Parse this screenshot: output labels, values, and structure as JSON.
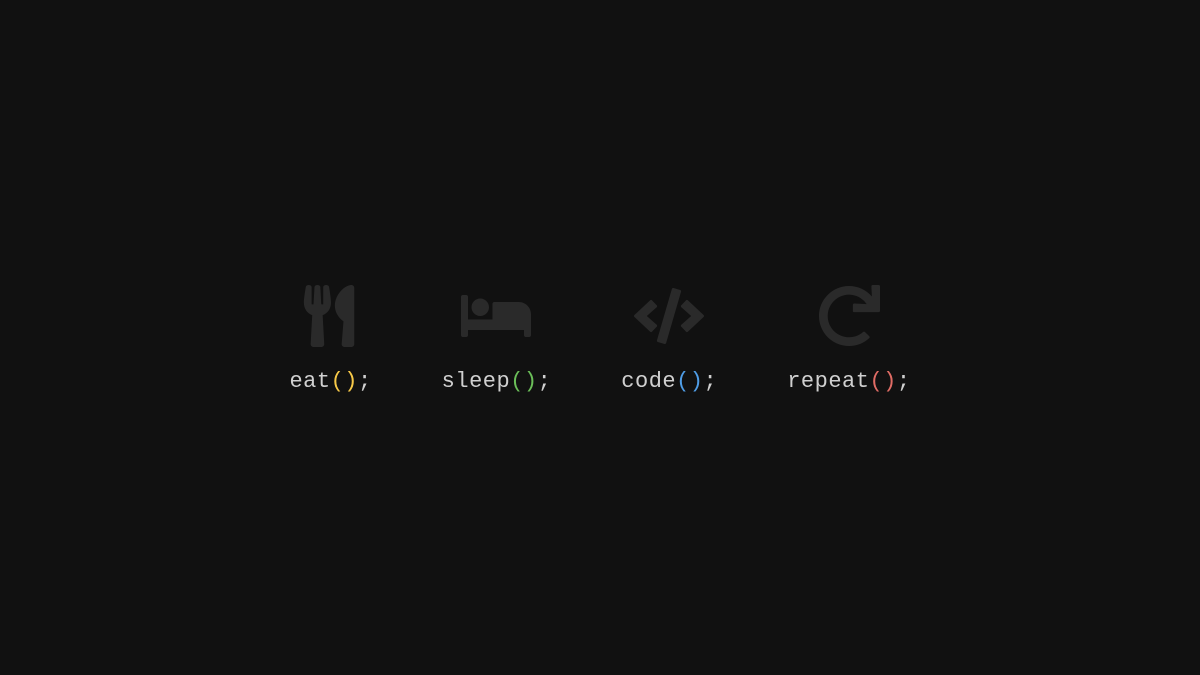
{
  "items": [
    {
      "name": "eat",
      "parens": "()",
      "semicolon": ";",
      "icon": "utensils-icon",
      "paren_color": "#f7c948"
    },
    {
      "name": "sleep",
      "parens": "()",
      "semicolon": ";",
      "icon": "bed-icon",
      "paren_color": "#6bbf59"
    },
    {
      "name": "code",
      "parens": "()",
      "semicolon": ";",
      "icon": "code-icon",
      "paren_color": "#4f9de6"
    },
    {
      "name": "repeat",
      "parens": "()",
      "semicolon": ";",
      "icon": "redo-icon",
      "paren_color": "#e06c65"
    }
  ],
  "colors": {
    "background": "#111111",
    "icon": "#2a2a2a",
    "text": "#d0d0d0"
  }
}
